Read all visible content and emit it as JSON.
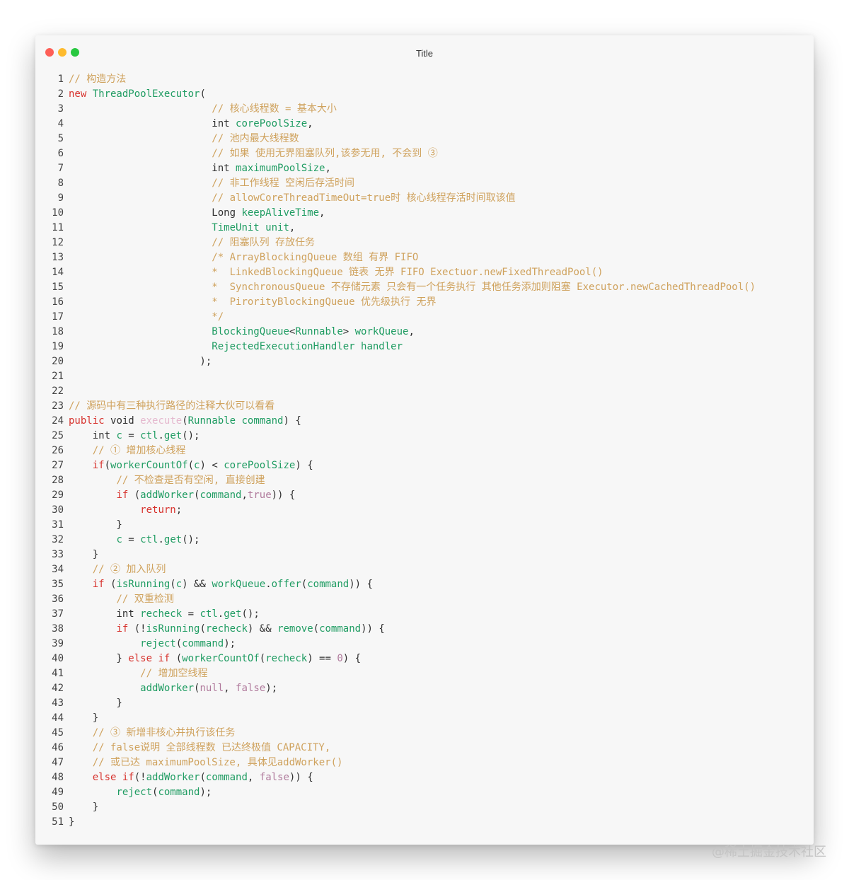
{
  "window": {
    "title": "Title"
  },
  "watermark": "@稀土掘金技术社区",
  "code_lines": [
    {
      "n": "1",
      "t": [
        [
          "cm",
          "// 构造方法"
        ]
      ]
    },
    {
      "n": "2",
      "t": [
        [
          "kw",
          "new "
        ],
        [
          "fn",
          "ThreadPoolExecutor"
        ],
        [
          "p",
          "("
        ]
      ]
    },
    {
      "n": "3",
      "t": [
        [
          "p",
          "                        "
        ],
        [
          "cm",
          "// 核心线程数 = 基本大小"
        ]
      ]
    },
    {
      "n": "4",
      "t": [
        [
          "p",
          "                        int "
        ],
        [
          "fn",
          "corePoolSize"
        ],
        [
          "p",
          ","
        ]
      ]
    },
    {
      "n": "5",
      "t": [
        [
          "p",
          "                        "
        ],
        [
          "cm",
          "// 池内最大线程数"
        ]
      ]
    },
    {
      "n": "6",
      "t": [
        [
          "p",
          "                        "
        ],
        [
          "cm",
          "// 如果 使用无界阻塞队列,该参无用, 不会到 ③"
        ]
      ]
    },
    {
      "n": "7",
      "t": [
        [
          "p",
          "                        int "
        ],
        [
          "fn",
          "maximumPoolSize"
        ],
        [
          "p",
          ","
        ]
      ]
    },
    {
      "n": "8",
      "t": [
        [
          "p",
          "                        "
        ],
        [
          "cm",
          "// 非工作线程 空闲后存活时间"
        ]
      ]
    },
    {
      "n": "9",
      "t": [
        [
          "p",
          "                        "
        ],
        [
          "cm",
          "// allowCoreThreadTimeOut=true时 核心线程存活时间取该值"
        ]
      ]
    },
    {
      "n": "10",
      "t": [
        [
          "p",
          "                        Long "
        ],
        [
          "fn",
          "keepAliveTime"
        ],
        [
          "p",
          ","
        ]
      ]
    },
    {
      "n": "11",
      "t": [
        [
          "p",
          "                        "
        ],
        [
          "fn",
          "TimeUnit unit"
        ],
        [
          "p",
          ","
        ]
      ]
    },
    {
      "n": "12",
      "t": [
        [
          "p",
          "                        "
        ],
        [
          "cm",
          "// 阻塞队列 存放任务"
        ]
      ]
    },
    {
      "n": "13",
      "t": [
        [
          "p",
          "                        "
        ],
        [
          "cm",
          "/* ArrayBlockingQueue 数组 有界 FIFO"
        ]
      ]
    },
    {
      "n": "14",
      "t": [
        [
          "p",
          "                        "
        ],
        [
          "cm",
          "*  LinkedBlockingQueue 链表 无界 FIFO Exectuor.newFixedThreadPool()"
        ]
      ]
    },
    {
      "n": "15",
      "t": [
        [
          "p",
          "                        "
        ],
        [
          "cm",
          "*  SynchronousQueue 不存储元素 只会有一个任务执行 其他任务添加则阻塞 Executor.newCachedThreadPool()"
        ]
      ]
    },
    {
      "n": "16",
      "t": [
        [
          "p",
          "                        "
        ],
        [
          "cm",
          "*  PirorityBlockingQueue 优先级执行 无界"
        ]
      ]
    },
    {
      "n": "17",
      "t": [
        [
          "p",
          "                        "
        ],
        [
          "cm",
          "*/"
        ]
      ]
    },
    {
      "n": "18",
      "t": [
        [
          "p",
          "                        "
        ],
        [
          "fn",
          "BlockingQueue"
        ],
        [
          "p",
          "<"
        ],
        [
          "fn",
          "Runnable"
        ],
        [
          "p",
          "> "
        ],
        [
          "fn",
          "workQueue"
        ],
        [
          "p",
          ","
        ]
      ]
    },
    {
      "n": "19",
      "t": [
        [
          "p",
          "                        "
        ],
        [
          "fn",
          "RejectedExecutionHandler handler"
        ]
      ]
    },
    {
      "n": "20",
      "t": [
        [
          "p",
          "                      );"
        ]
      ]
    },
    {
      "n": "21",
      "t": []
    },
    {
      "n": "22",
      "t": []
    },
    {
      "n": "23",
      "t": [
        [
          "cm",
          "// 源码中有三种执行路径的注释大伙可以看看"
        ]
      ]
    },
    {
      "n": "24",
      "t": [
        [
          "kw",
          "public "
        ],
        [
          "p",
          "void "
        ],
        [
          "ex",
          "execute"
        ],
        [
          "p",
          "("
        ],
        [
          "fn",
          "Runnable command"
        ],
        [
          "p",
          ") {"
        ]
      ]
    },
    {
      "n": "25",
      "t": [
        [
          "p",
          "    int "
        ],
        [
          "fn",
          "c"
        ],
        [
          "p",
          " = "
        ],
        [
          "fn",
          "ctl"
        ],
        [
          "p",
          "."
        ],
        [
          "fn",
          "get"
        ],
        [
          "p",
          "();"
        ]
      ]
    },
    {
      "n": "26",
      "t": [
        [
          "p",
          "    "
        ],
        [
          "cm",
          "// ① 增加核心线程"
        ]
      ]
    },
    {
      "n": "27",
      "t": [
        [
          "p",
          "    "
        ],
        [
          "kw",
          "if"
        ],
        [
          "p",
          "("
        ],
        [
          "fn",
          "workerCountOf"
        ],
        [
          "p",
          "("
        ],
        [
          "fn",
          "c"
        ],
        [
          "p",
          ") < "
        ],
        [
          "fn",
          "corePoolSize"
        ],
        [
          "p",
          ") {"
        ]
      ]
    },
    {
      "n": "28",
      "t": [
        [
          "p",
          "        "
        ],
        [
          "cm",
          "// 不检查是否有空闲, 直接创建"
        ]
      ]
    },
    {
      "n": "29",
      "t": [
        [
          "p",
          "        "
        ],
        [
          "kw",
          "if"
        ],
        [
          "p",
          " ("
        ],
        [
          "fn",
          "addWorker"
        ],
        [
          "p",
          "("
        ],
        [
          "fn",
          "command"
        ],
        [
          "p",
          ","
        ],
        [
          "num",
          "true"
        ],
        [
          "p",
          ")) {"
        ]
      ]
    },
    {
      "n": "30",
      "t": [
        [
          "p",
          "            "
        ],
        [
          "kw",
          "return"
        ],
        [
          "p",
          ";"
        ]
      ]
    },
    {
      "n": "31",
      "t": [
        [
          "p",
          "        }"
        ]
      ]
    },
    {
      "n": "32",
      "t": [
        [
          "p",
          "        "
        ],
        [
          "fn",
          "c"
        ],
        [
          "p",
          " = "
        ],
        [
          "fn",
          "ctl"
        ],
        [
          "p",
          "."
        ],
        [
          "fn",
          "get"
        ],
        [
          "p",
          "();"
        ]
      ]
    },
    {
      "n": "33",
      "t": [
        [
          "p",
          "    }"
        ]
      ]
    },
    {
      "n": "34",
      "t": [
        [
          "p",
          "    "
        ],
        [
          "cm",
          "// ② 加入队列"
        ]
      ]
    },
    {
      "n": "35",
      "t": [
        [
          "p",
          "    "
        ],
        [
          "kw",
          "if"
        ],
        [
          "p",
          " ("
        ],
        [
          "fn",
          "isRunning"
        ],
        [
          "p",
          "("
        ],
        [
          "fn",
          "c"
        ],
        [
          "p",
          ") && "
        ],
        [
          "fn",
          "workQueue"
        ],
        [
          "p",
          "."
        ],
        [
          "fn",
          "offer"
        ],
        [
          "p",
          "("
        ],
        [
          "fn",
          "command"
        ],
        [
          "p",
          ")) {"
        ]
      ]
    },
    {
      "n": "36",
      "t": [
        [
          "p",
          "        "
        ],
        [
          "cm",
          "// 双重检测"
        ]
      ]
    },
    {
      "n": "37",
      "t": [
        [
          "p",
          "        int "
        ],
        [
          "fn",
          "recheck"
        ],
        [
          "p",
          " = "
        ],
        [
          "fn",
          "ctl"
        ],
        [
          "p",
          "."
        ],
        [
          "fn",
          "get"
        ],
        [
          "p",
          "();"
        ]
      ]
    },
    {
      "n": "38",
      "t": [
        [
          "p",
          "        "
        ],
        [
          "kw",
          "if"
        ],
        [
          "p",
          " (!"
        ],
        [
          "fn",
          "isRunning"
        ],
        [
          "p",
          "("
        ],
        [
          "fn",
          "recheck"
        ],
        [
          "p",
          ") && "
        ],
        [
          "fn",
          "remove"
        ],
        [
          "p",
          "("
        ],
        [
          "fn",
          "command"
        ],
        [
          "p",
          ")) {"
        ]
      ]
    },
    {
      "n": "39",
      "t": [
        [
          "p",
          "            "
        ],
        [
          "fn",
          "reject"
        ],
        [
          "p",
          "("
        ],
        [
          "fn",
          "command"
        ],
        [
          "p",
          ");"
        ]
      ]
    },
    {
      "n": "40",
      "t": [
        [
          "p",
          "        } "
        ],
        [
          "kw",
          "else if"
        ],
        [
          "p",
          " ("
        ],
        [
          "fn",
          "workerCountOf"
        ],
        [
          "p",
          "("
        ],
        [
          "fn",
          "recheck"
        ],
        [
          "p",
          ") == "
        ],
        [
          "num",
          "0"
        ],
        [
          "p",
          ") {"
        ]
      ]
    },
    {
      "n": "41",
      "t": [
        [
          "p",
          "            "
        ],
        [
          "cm",
          "// 增加空线程"
        ]
      ]
    },
    {
      "n": "42",
      "t": [
        [
          "p",
          "            "
        ],
        [
          "fn",
          "addWorker"
        ],
        [
          "p",
          "("
        ],
        [
          "num",
          "null"
        ],
        [
          "p",
          ", "
        ],
        [
          "num",
          "false"
        ],
        [
          "p",
          ");"
        ]
      ]
    },
    {
      "n": "43",
      "t": [
        [
          "p",
          "        }"
        ]
      ]
    },
    {
      "n": "44",
      "t": [
        [
          "p",
          "    }"
        ]
      ]
    },
    {
      "n": "45",
      "t": [
        [
          "p",
          "    "
        ],
        [
          "cm",
          "// ③ 新增非核心并执行该任务"
        ]
      ]
    },
    {
      "n": "46",
      "t": [
        [
          "p",
          "    "
        ],
        [
          "cm",
          "// false说明 全部线程数 已达终极值 CAPACITY,"
        ]
      ]
    },
    {
      "n": "47",
      "t": [
        [
          "p",
          "    "
        ],
        [
          "cm",
          "// 或已达 maximumPoolSize, 具体见addWorker()"
        ]
      ]
    },
    {
      "n": "48",
      "t": [
        [
          "p",
          "    "
        ],
        [
          "kw",
          "else if"
        ],
        [
          "p",
          "(!"
        ],
        [
          "fn",
          "addWorker"
        ],
        [
          "p",
          "("
        ],
        [
          "fn",
          "command"
        ],
        [
          "p",
          ", "
        ],
        [
          "num",
          "false"
        ],
        [
          "p",
          ")) {"
        ]
      ]
    },
    {
      "n": "49",
      "t": [
        [
          "p",
          "        "
        ],
        [
          "fn",
          "reject"
        ],
        [
          "p",
          "("
        ],
        [
          "fn",
          "command"
        ],
        [
          "p",
          ");"
        ]
      ]
    },
    {
      "n": "50",
      "t": [
        [
          "p",
          "    }"
        ]
      ]
    },
    {
      "n": "51",
      "t": [
        [
          "p",
          "}"
        ]
      ]
    }
  ]
}
